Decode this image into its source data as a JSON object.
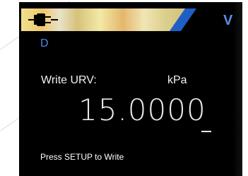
{
  "status_bar": {
    "power_icon": "plug-icon",
    "accent_color": "#1f5ec6"
  },
  "indicators": {
    "v_mark": "V",
    "mode": "D"
  },
  "prompt": {
    "label": "Write URV:",
    "unit": "kPa"
  },
  "value": "15.0000",
  "help_text": "Press SETUP to Write",
  "colors": {
    "screen_bg": "#000000",
    "text": "#f0f0f0",
    "blue": "#4f86e8"
  }
}
